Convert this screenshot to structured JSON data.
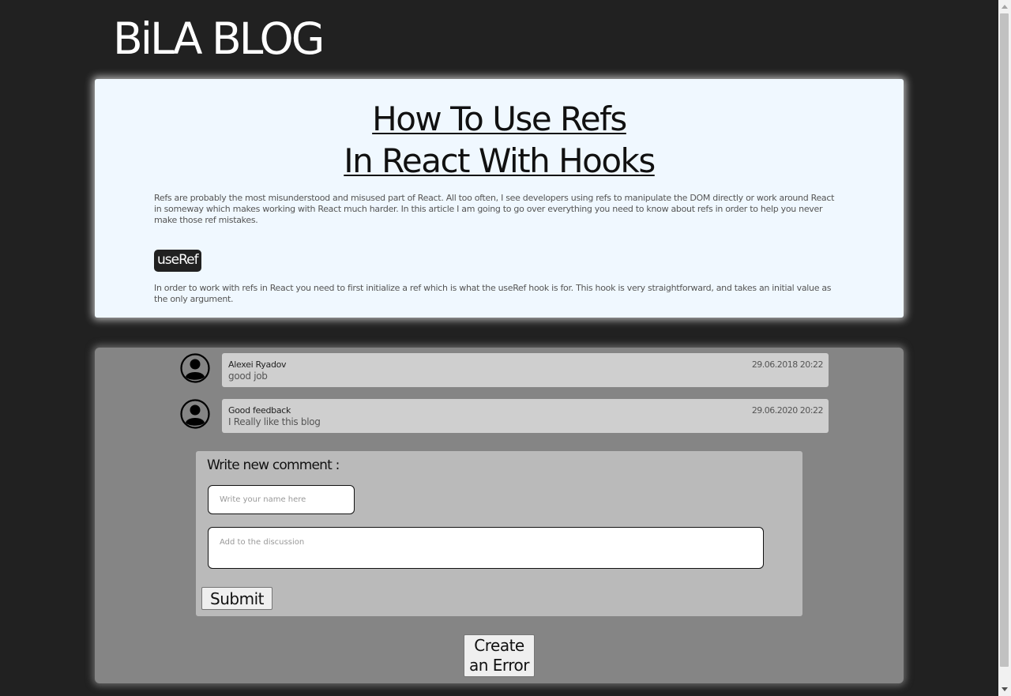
{
  "header": {
    "logo": "BiLA BLOG"
  },
  "article": {
    "title_line1": "How To Use Refs",
    "title_line2": "In React With Hooks",
    "intro": "Refs are probably the most misunderstood and misused part of React. All too often, I see developers using refs to manipulate the DOM directly or work around React in someway which makes working with React much harder. In this article I am going to go over everything you need to know about refs in order to help you never make those ref mistakes.",
    "section_badge": "useRef",
    "section_text": "In order to work with refs in React you need to first initialize a ref which is what the useRef hook is for. This hook is very straightforward, and takes an initial value as the only argument."
  },
  "comments": [
    {
      "author": "Alexei Ryadov",
      "date": "29.06.2018 20:22",
      "text": "good job",
      "avatar_icon": "user-avatar-icon"
    },
    {
      "author": "Good feedback",
      "date": "29.06.2020 20:22",
      "text": "I Really like this blog",
      "avatar_icon": "user-avatar-icon"
    }
  ],
  "form": {
    "heading": "Write new comment :",
    "name_placeholder": "Write your name here",
    "name_value": "",
    "discussion_placeholder": "Add to the discussion",
    "discussion_value": "",
    "submit_label": "Submit"
  },
  "actions": {
    "error_label_line1": "Create",
    "error_label_line2": "an Error"
  },
  "colors": {
    "page_background": "#212121",
    "article_background": "#f0f8ff",
    "comments_panel": "#858585",
    "comment_box": "#cfcfcf",
    "form_box": "#bababa"
  }
}
